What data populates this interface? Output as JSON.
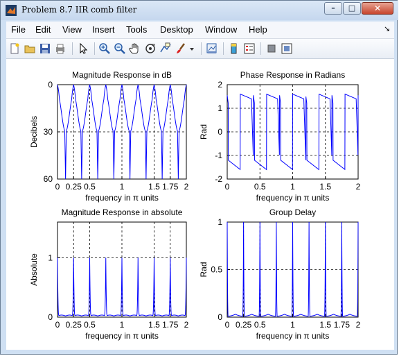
{
  "window": {
    "title": "Problem 8.7 IIR comb filter",
    "controls": {
      "minimize": "–",
      "maximize": "□",
      "close": "✕"
    }
  },
  "menu": {
    "items": [
      "File",
      "Edit",
      "View",
      "Insert",
      "Tools",
      "Desktop",
      "Window",
      "Help"
    ],
    "dock_arrow": "↘"
  },
  "toolbar": {
    "icons": [
      "new-figure-icon",
      "open-file-icon",
      "save-icon",
      "print-icon",
      "edit-plot-arrow-icon",
      "zoom-in-icon",
      "zoom-out-icon",
      "pan-hand-icon",
      "rotate-3d-icon",
      "data-cursor-icon",
      "brush-icon",
      "brush-dropdown-icon",
      "link-plot-icon",
      "insert-colorbar-icon",
      "insert-legend-icon",
      "hide-plot-tools-icon",
      "show-plot-tools-icon"
    ]
  },
  "colors": {
    "trace": "#0000ff",
    "titlebar": "#c5d7ee",
    "figure_bg": "#ffffff"
  },
  "chart_data": [
    {
      "type": "line",
      "title": "Magnitude Response in dB",
      "xlabel": "frequency in π units",
      "ylabel": "Decibels",
      "xlim": [
        0,
        2
      ],
      "ylim": [
        0,
        60
      ],
      "y_reversed": true,
      "grid": true,
      "xticks": [
        0,
        0.25,
        0.5,
        1,
        1.5,
        1.75,
        2
      ],
      "xtick_labels": [
        "0",
        "0.25",
        "0.5",
        "1",
        "1.5",
        "1.75",
        "2"
      ],
      "yticks": [
        0,
        30,
        60
      ],
      "ytick_labels": [
        "0",
        "30",
        "60"
      ],
      "peaks_at": [
        0.25,
        0.5,
        0.75,
        1,
        1.25,
        1.5,
        1.75,
        2
      ],
      "series": [
        {
          "x": [
            0,
            0.05,
            0.1,
            0.15,
            0.2,
            0.235,
            0.25,
            0.265,
            0.3,
            0.35,
            0.4,
            0.45,
            0.5
          ],
          "y": [
            40,
            35,
            32,
            31,
            33,
            45,
            60,
            45,
            33,
            31,
            32,
            35,
            40
          ]
        }
      ],
      "note_period": 0.25
    },
    {
      "type": "line",
      "title": "Phase Response in Radians",
      "xlabel": "frequency in π units",
      "ylabel": "Rad",
      "xlim": [
        0,
        2
      ],
      "ylim": [
        -2,
        2
      ],
      "grid": true,
      "xticks": [
        0,
        0.5,
        1,
        1.5,
        2
      ],
      "xtick_labels": [
        "0",
        "0.5",
        "1",
        "1.5",
        "2"
      ],
      "yticks": [
        -2,
        -1,
        0,
        1,
        2
      ],
      "ytick_labels": [
        "-2",
        "-1",
        "0",
        "1",
        "2"
      ],
      "series": [
        {
          "x": [
            0,
            0.005,
            0.02,
            0.05,
            0.1,
            0.15,
            0.185,
            0.19,
            0.195,
            0.2,
            0.23,
            0.3,
            0.37,
            0.385,
            0.39,
            0.395,
            0.4
          ],
          "y": [
            -1.1,
            -1.3,
            -1.4,
            -1.45,
            -1.5,
            -1.55,
            -1.6,
            0,
            1.6,
            1.55,
            1.5,
            1.45,
            1.4,
            1.3,
            0.7,
            -1.1,
            -1.3
          ]
        }
      ],
      "note_period": 0.4
    },
    {
      "type": "line",
      "title": "Magnitude Response in absolute",
      "xlabel": "frequency in π units",
      "ylabel": "Absolute",
      "xlim": [
        0,
        2
      ],
      "ylim": [
        0,
        1.6
      ],
      "grid": true,
      "xticks": [
        0,
        0.25,
        0.5,
        1,
        1.5,
        1.75,
        2
      ],
      "xtick_labels": [
        "0",
        "0.25",
        "0.5",
        "1",
        "1.5",
        "1.75",
        "2"
      ],
      "yticks": [
        0,
        1
      ],
      "ytick_labels": [
        "0",
        "1"
      ],
      "series": [
        {
          "x": [
            0,
            0.05,
            0.1,
            0.15,
            0.2,
            0.23,
            0.245,
            0.25,
            0.255,
            0.27,
            0.3,
            0.35,
            0.4,
            0.45,
            0.5
          ],
          "y": [
            0.01,
            0.018,
            0.025,
            0.028,
            0.025,
            0.1,
            0.6,
            1,
            0.6,
            0.1,
            0.025,
            0.028,
            0.025,
            0.018,
            0.01
          ]
        }
      ],
      "note_period": 0.4
    },
    {
      "type": "line",
      "title": "Group Delay",
      "xlabel": "frequency in π units",
      "ylabel": "Rad",
      "xlim": [
        0,
        2
      ],
      "ylim": [
        0,
        1
      ],
      "grid": true,
      "xticks": [
        0,
        0.25,
        0.5,
        1,
        1.5,
        1.75,
        2
      ],
      "xtick_labels": [
        "0",
        "0.25",
        "0.5",
        "1",
        "1.5",
        "1.75",
        "2"
      ],
      "yticks": [
        0,
        0.5,
        1
      ],
      "ytick_labels": [
        "0",
        "0.5",
        "1"
      ],
      "series": [
        {
          "x": [
            0,
            0.05,
            0.1,
            0.15,
            0.19,
            0.195,
            0.2,
            0.205,
            0.21,
            0.25,
            0.3,
            0.35,
            0.4
          ],
          "y": [
            0.04,
            0.01,
            0.005,
            0.01,
            0.1,
            0.6,
            1,
            0.6,
            0.1,
            0.01,
            0.005,
            0.01,
            0.04
          ]
        }
      ],
      "note_period": 0.4
    }
  ]
}
